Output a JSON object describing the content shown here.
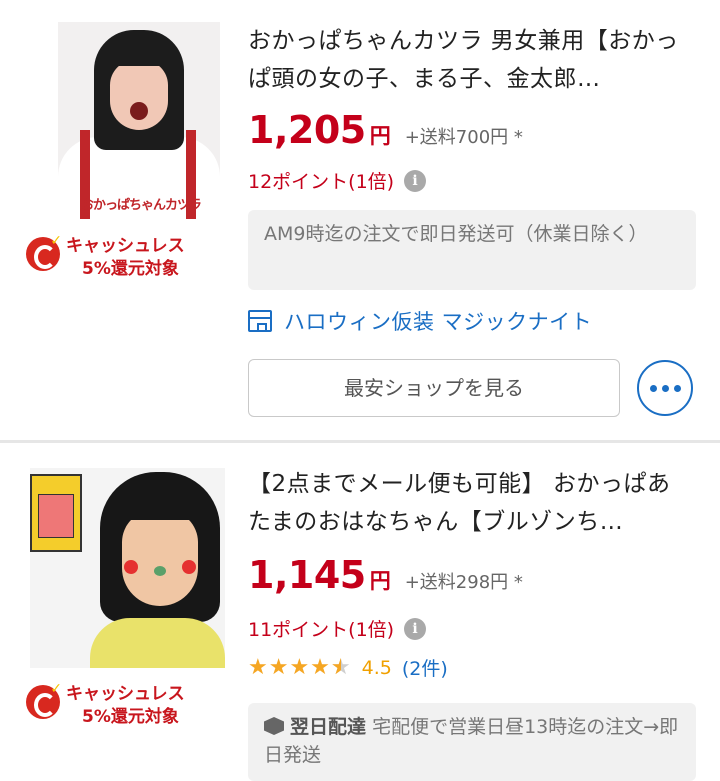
{
  "items": [
    {
      "title": "おかっぱちゃんカツラ 男女兼用【おかっぱ頭の女の子、まる子、金太郎…",
      "image_caption": "おかっぱちゃんカツラ",
      "price": "1,205",
      "currency": "円",
      "shipping": "+送料700円 *",
      "points": "12ポイント(1倍)",
      "cashless_line1": "キャッシュレス",
      "cashless_line2": "5%還元対象",
      "shipping_note": "AM9時迄の注文で即日発送可（休業日除く）",
      "shop_name": "ハロウィン仮装 マジックナイト",
      "cheapest_button": "最安ショップを見る"
    },
    {
      "title": "【2点までメール便も可能】 おかっぱあたまのおはなちゃん【ブルゾンち…",
      "price": "1,145",
      "currency": "円",
      "shipping": "+送料298円 *",
      "points": "11ポイント(1倍)",
      "rating_value": "4.5",
      "rating_stars": 4.5,
      "review_count": "(2件)",
      "cashless_line1": "キャッシュレス",
      "cashless_line2": "5%還元対象",
      "nextday_label": "翌日配達",
      "nextday_note": "宅配便で営業日昼13時迄の注文→即日発送"
    }
  ],
  "colors": {
    "price": "#c4001a",
    "link": "#1a6ec4",
    "star": "#f5a623",
    "cashless": "#c8161d"
  },
  "icons": {
    "info": "info-icon",
    "shop": "store-icon",
    "more": "more-dots-icon",
    "cashless": "cashless-c-icon",
    "delivery": "box-icon"
  }
}
